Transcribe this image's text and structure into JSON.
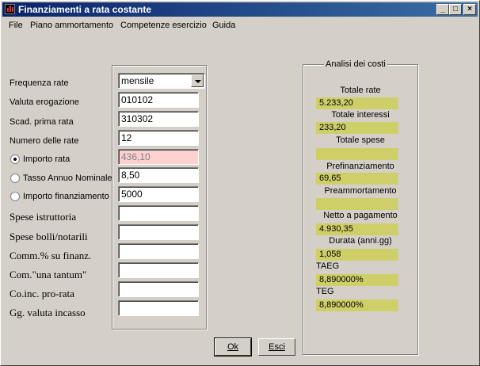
{
  "window": {
    "title": "Finanziamenti a rata costante"
  },
  "menu": [
    {
      "label": "File"
    },
    {
      "label": "Piano ammortamento"
    },
    {
      "label": "Competenze esercizio"
    },
    {
      "label": "Guida"
    }
  ],
  "form": {
    "frequenza_label": "Frequenza rate",
    "frequenza_value": "mensile",
    "valuta_label": "Valuta erogazione",
    "valuta_value": "010102",
    "scad_label": "Scad. prima rata",
    "scad_value": "310302",
    "numero_label": "Numero delle rate",
    "numero_value": "12",
    "importo_rata_label": "Importo rata",
    "importo_rata_value": "436,10",
    "tasso_label": "Tasso Annuo Nominale",
    "tasso_value": "8,50",
    "importo_fin_label": "Importo finanziamento",
    "importo_fin_value": "5000",
    "spese_istr_label": "Spese istruttoria",
    "spese_bolli_label": "Spese bolli/notarili",
    "comm_label": "Comm.% su finanz.",
    "una_tantum_label": "Com.\"una tantum\"",
    "coinc_label": "Co.inc. pro-rata",
    "gg_label": "Gg. valuta incasso"
  },
  "costs": {
    "group_title": "Analisi dei costi",
    "totale_rate_label": "Totale rate",
    "totale_rate_value": "5.233,20",
    "totale_interessi_label": "Totale interessi",
    "totale_interessi_value": "233,20",
    "totale_spese_label": "Totale spese",
    "totale_spese_value": "",
    "prefin_label": "Prefinanziamento",
    "prefin_value": "69,65",
    "preamm_label": "Preammortamento",
    "preamm_value": "",
    "netto_label": "Netto a pagamento",
    "netto_value": "4.930,35",
    "durata_label": "Durata (anni.gg)",
    "durata_value": "1,058",
    "taeg_label": "TAEG",
    "taeg_value": "8,890000%",
    "teg_label": "TEG",
    "teg_value": "8,890000%"
  },
  "buttons": {
    "ok_label": "Ok",
    "esci_label": "Esci"
  },
  "colors": {
    "title_bar": "#0a246a",
    "value_bg": "#cfcf6a",
    "disabled_bg": "#ffd0d0"
  }
}
